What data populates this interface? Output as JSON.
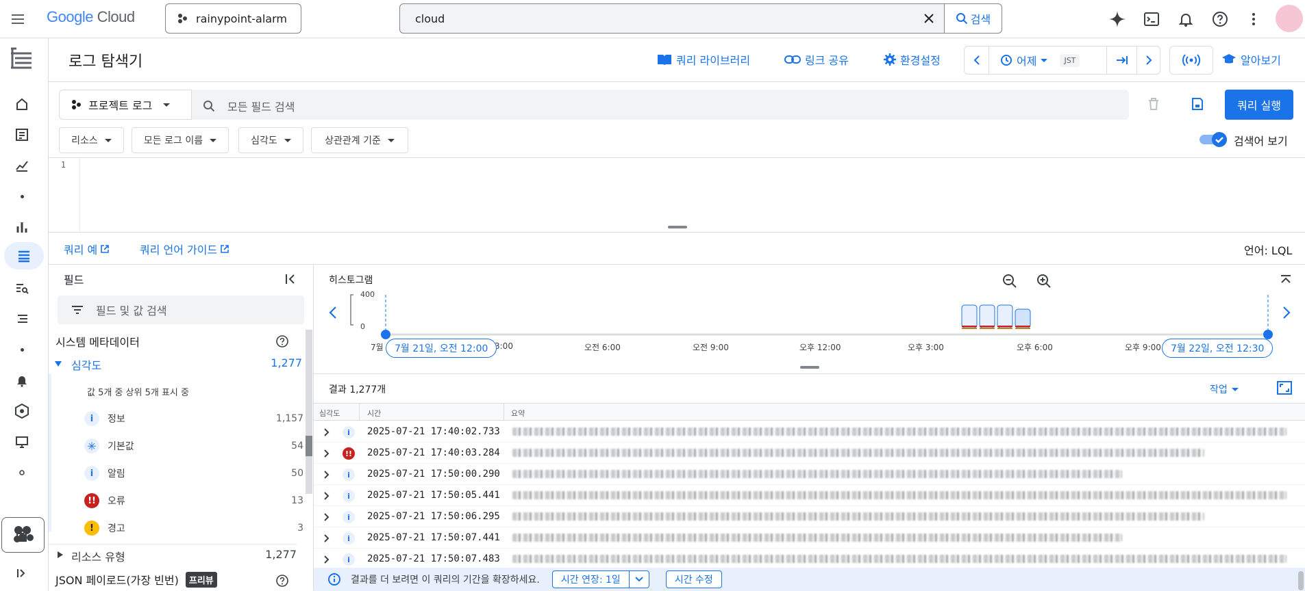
{
  "topbar": {
    "brand_google": "Google",
    "brand_cloud": "Cloud",
    "project_name": "rainypoint-alarm",
    "search_value": "cloud",
    "search_button": "검색"
  },
  "header": {
    "title": "로그 탐색기",
    "query_library": "쿼리 라이브러리",
    "share_link": "링크 공유",
    "settings": "환경설정",
    "time_range": "어제",
    "timezone": "JST",
    "learn": "알아보기"
  },
  "query": {
    "project_logs": "프로젝트 로그",
    "search_placeholder": "모든 필드 검색",
    "run_button": "쿼리 실행",
    "chips": [
      "리소스",
      "모든 로그 이름",
      "심각도",
      "상관관계 기준"
    ],
    "show_query_label": "검색어 보기",
    "show_query_on": true,
    "line_number": "1",
    "examples_link": "쿼리 예",
    "guide_link": "쿼리 언어 가이드",
    "language_label": "언어: LQL"
  },
  "fields": {
    "title": "필드",
    "search_placeholder": "필드 및 값 검색",
    "system_metadata": "시스템 메타데이터",
    "severity_label": "심각도",
    "severity_count": "1,277",
    "severity_summary": "값 5개 중 상위 5개 표시 중",
    "severity_values": [
      {
        "label": "정보",
        "count": "1,157",
        "icon": "info-icon"
      },
      {
        "label": "기본값",
        "count": "54",
        "icon": "asterisk-icon"
      },
      {
        "label": "알림",
        "count": "50",
        "icon": "info-icon"
      },
      {
        "label": "오류",
        "count": "13",
        "icon": "error-icon"
      },
      {
        "label": "경고",
        "count": "3",
        "icon": "warning-icon"
      }
    ],
    "resource_type_label": "리소스 유형",
    "resource_type_count": "1,277",
    "json_payload_label": "JSON 페이로드(가장 빈번)",
    "preview_badge": "프리뷰"
  },
  "histogram": {
    "title": "히스토그램",
    "y_max": "400",
    "y_min": "0",
    "start_pill": "7월 21일, 오전 12:00",
    "end_pill": "7월 22일, 오전 12:30",
    "start_month": "7월",
    "ticks": [
      "3:00",
      "오전 6:00",
      "오전 9:00",
      "오후 12:00",
      "오후 3:00",
      "오후 6:00",
      "오후 9:00"
    ],
    "bars_normalized": [
      0.55,
      0.55,
      0.55,
      0.45
    ]
  },
  "results": {
    "count_label": "결과 1,277개",
    "actions_label": "작업",
    "columns": [
      "심각도",
      "시간",
      "요약"
    ],
    "rows": [
      {
        "severity": "info",
        "time": "2025-07-21 17:40:02.733"
      },
      {
        "severity": "error",
        "time": "2025-07-21 17:40:03.284"
      },
      {
        "severity": "info",
        "time": "2025-07-21 17:50:00.290"
      },
      {
        "severity": "info",
        "time": "2025-07-21 17:50:05.441"
      },
      {
        "severity": "info",
        "time": "2025-07-21 17:50:06.295"
      },
      {
        "severity": "info",
        "time": "2025-07-21 17:50:07.441"
      },
      {
        "severity": "info",
        "time": "2025-07-21 17:50:07.483"
      }
    ],
    "info_text": "결과를 더 보려면 이 쿼리의 기간을 확장하세요.",
    "extend_button": "시간 연장: 1일",
    "edit_time_button": "시간 수정"
  },
  "colors": {
    "accent": "#1a73e8",
    "error": "#c5221f",
    "warning": "#fbbc04",
    "selected_bg": "#e8f0fe"
  }
}
